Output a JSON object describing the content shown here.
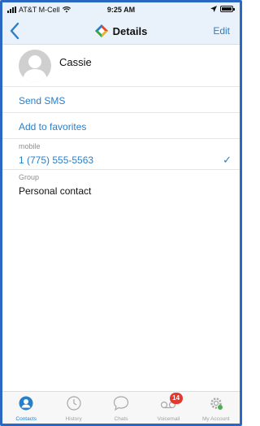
{
  "status_bar": {
    "carrier": "AT&T M-Cell",
    "time": "9:25 AM"
  },
  "nav": {
    "title": "Details",
    "edit_label": "Edit",
    "icon": "diamond-logo-icon"
  },
  "contact": {
    "name": "Cassie"
  },
  "actions": {
    "send_sms": "Send SMS",
    "add_favorites": "Add to favorites"
  },
  "fields": {
    "mobile_label": "mobile",
    "mobile_value": "1 (775) 555-5563",
    "group_label": "Group",
    "group_value": "Personal contact"
  },
  "tabs": [
    {
      "label": "Contacts",
      "icon": "contacts-icon",
      "active": true
    },
    {
      "label": "History",
      "icon": "clock-icon",
      "active": false
    },
    {
      "label": "Chats",
      "icon": "chat-bubble-icon",
      "active": false
    },
    {
      "label": "Voicemail",
      "icon": "voicemail-icon",
      "active": false,
      "badge": "14"
    },
    {
      "label": "My Account",
      "icon": "gear-icon",
      "active": false
    }
  ],
  "colors": {
    "accent": "#2a7fc8",
    "badge": "#e03a2e",
    "header_bg": "#e9f2fa"
  }
}
